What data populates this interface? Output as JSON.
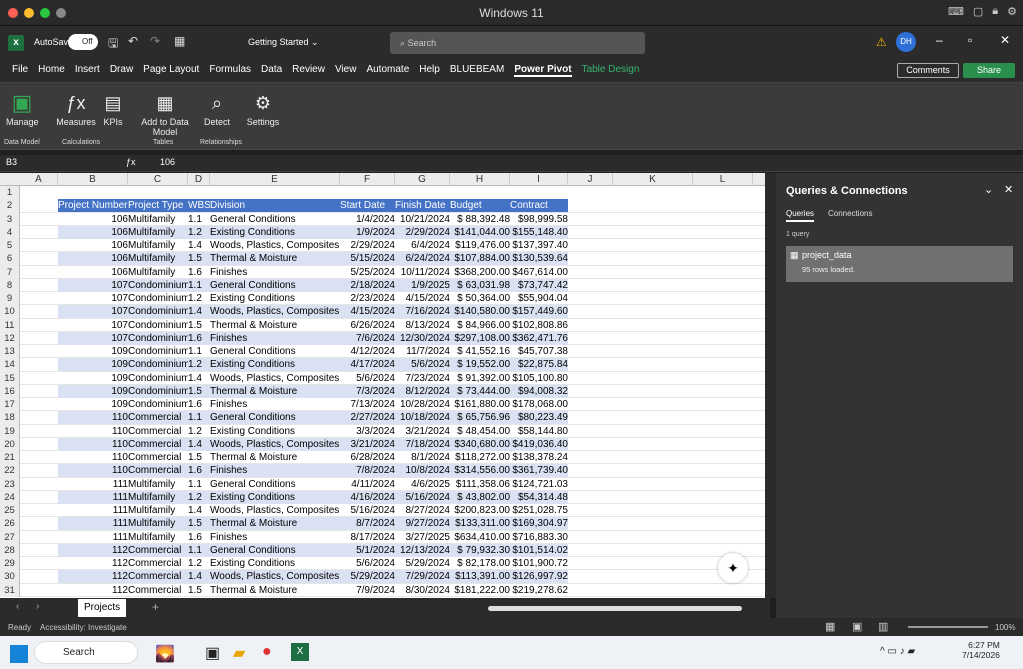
{
  "window": {
    "title": "Windows 11"
  },
  "titlebar": {
    "autosave": "AutoSave",
    "autosave_state": "Off",
    "filename": "Getting Started",
    "search_placeholder": "Search",
    "user_initials": "DH"
  },
  "menu": [
    "File",
    "Home",
    "Insert",
    "Draw",
    "Page Layout",
    "Formulas",
    "Data",
    "Review",
    "View",
    "Automate",
    "Help",
    "BLUEBEAM",
    "Power Pivot",
    "Table Design"
  ],
  "menu_actions": {
    "comments": "Comments",
    "share": "Share"
  },
  "ribbon": {
    "items": [
      {
        "label": "Manage",
        "icon": "manage-icon"
      },
      {
        "label": "Measures",
        "icon": "fx-icon"
      },
      {
        "label": "KPIs",
        "icon": "kpi-icon"
      },
      {
        "label": "Add to Data Model",
        "icon": "table-add-icon"
      },
      {
        "label": "Detect",
        "icon": "detect-icon"
      },
      {
        "label": "Settings",
        "icon": "gear-icon"
      }
    ],
    "groups": [
      "Data Model",
      "Calculations",
      "Tables",
      "Relationships"
    ]
  },
  "formula": {
    "cell": "B3",
    "value": "106"
  },
  "columns": [
    "A",
    "B",
    "C",
    "D",
    "E",
    "F",
    "G",
    "H",
    "I",
    "J",
    "K",
    "L"
  ],
  "table": {
    "headers": [
      "Project Number",
      "Project Type",
      "WBS",
      "Division",
      "Start Date",
      "Finish Date",
      "Budget",
      "Contract"
    ],
    "rows": [
      [
        "106",
        "Multifamily",
        "1.1",
        "General Conditions",
        "1/4/2024",
        "10/21/2024",
        "$ 88,392.48",
        "$98,999.58"
      ],
      [
        "106",
        "Multifamily",
        "1.2",
        "Existing Conditions",
        "1/9/2024",
        "2/29/2024",
        "$141,044.00",
        "$155,148.40"
      ],
      [
        "106",
        "Multifamily",
        "1.4",
        "Woods, Plastics, Composites",
        "2/29/2024",
        "6/4/2024",
        "$119,476.00",
        "$137,397.40"
      ],
      [
        "106",
        "Multifamily",
        "1.5",
        "Thermal & Moisture",
        "5/15/2024",
        "6/24/2024",
        "$107,884.00",
        "$130,539.64"
      ],
      [
        "106",
        "Multifamily",
        "1.6",
        "Finishes",
        "5/25/2024",
        "10/11/2024",
        "$368,200.00",
        "$467,614.00"
      ],
      [
        "107",
        "Condominium",
        "1.1",
        "General Conditions",
        "2/18/2024",
        "1/9/2025",
        "$ 63,031.98",
        "$73,747.42"
      ],
      [
        "107",
        "Condominium",
        "1.2",
        "Existing Conditions",
        "2/23/2024",
        "4/15/2024",
        "$ 50,364.00",
        "$55,904.04"
      ],
      [
        "107",
        "Condominium",
        "1.4",
        "Woods, Plastics, Composites",
        "4/15/2024",
        "7/16/2024",
        "$140,580.00",
        "$157,449.60"
      ],
      [
        "107",
        "Condominium",
        "1.5",
        "Thermal & Moisture",
        "6/26/2024",
        "8/13/2024",
        "$ 84,966.00",
        "$102,808.86"
      ],
      [
        "107",
        "Condominium",
        "1.6",
        "Finishes",
        "7/6/2024",
        "12/30/2024",
        "$297,108.00",
        "$362,471.76"
      ],
      [
        "109",
        "Condominium",
        "1.1",
        "General Conditions",
        "4/12/2024",
        "11/7/2024",
        "$ 41,552.16",
        "$45,707.38"
      ],
      [
        "109",
        "Condominium",
        "1.2",
        "Existing Conditions",
        "4/17/2024",
        "5/6/2024",
        "$ 19,552.00",
        "$22,875.84"
      ],
      [
        "109",
        "Condominium",
        "1.4",
        "Woods, Plastics, Composites",
        "5/6/2024",
        "7/23/2024",
        "$ 91,392.00",
        "$105,100.80"
      ],
      [
        "109",
        "Condominium",
        "1.5",
        "Thermal & Moisture",
        "7/3/2024",
        "8/12/2024",
        "$ 73,444.00",
        "$94,008.32"
      ],
      [
        "109",
        "Condominium",
        "1.6",
        "Finishes",
        "7/13/2024",
        "10/28/2024",
        "$161,880.00",
        "$178,068.00"
      ],
      [
        "110",
        "Commercial",
        "1.1",
        "General Conditions",
        "2/27/2024",
        "10/18/2024",
        "$ 65,756.96",
        "$80,223.49"
      ],
      [
        "110",
        "Commercial",
        "1.2",
        "Existing Conditions",
        "3/3/2024",
        "3/21/2024",
        "$ 48,454.00",
        "$58,144.80"
      ],
      [
        "110",
        "Commercial",
        "1.4",
        "Woods, Plastics, Composites",
        "3/21/2024",
        "7/18/2024",
        "$340,680.00",
        "$419,036.40"
      ],
      [
        "110",
        "Commercial",
        "1.5",
        "Thermal & Moisture",
        "6/28/2024",
        "8/1/2024",
        "$118,272.00",
        "$138,378.24"
      ],
      [
        "110",
        "Commercial",
        "1.6",
        "Finishes",
        "7/8/2024",
        "10/8/2024",
        "$314,556.00",
        "$361,739.40"
      ],
      [
        "111",
        "Multifamily",
        "1.1",
        "General Conditions",
        "4/11/2024",
        "4/6/2025",
        "$111,358.06",
        "$124,721.03"
      ],
      [
        "111",
        "Multifamily",
        "1.2",
        "Existing Conditions",
        "4/16/2024",
        "5/16/2024",
        "$ 43,802.00",
        "$54,314.48"
      ],
      [
        "111",
        "Multifamily",
        "1.4",
        "Woods, Plastics, Composites",
        "5/16/2024",
        "8/27/2024",
        "$200,823.00",
        "$251,028.75"
      ],
      [
        "111",
        "Multifamily",
        "1.5",
        "Thermal & Moisture",
        "8/7/2024",
        "9/27/2024",
        "$133,311.00",
        "$169,304.97"
      ],
      [
        "111",
        "Multifamily",
        "1.6",
        "Finishes",
        "8/17/2024",
        "3/27/2025",
        "$634,410.00",
        "$716,883.30"
      ],
      [
        "112",
        "Commercial",
        "1.1",
        "General Conditions",
        "5/1/2024",
        "12/13/2024",
        "$ 79,932.30",
        "$101,514.02"
      ],
      [
        "112",
        "Commercial",
        "1.2",
        "Existing Conditions",
        "5/6/2024",
        "5/29/2024",
        "$ 82,178.00",
        "$101,900.72"
      ],
      [
        "112",
        "Commercial",
        "1.4",
        "Woods, Plastics, Composites",
        "5/29/2024",
        "7/29/2024",
        "$113,391.00",
        "$126,997.92"
      ],
      [
        "112",
        "Commercial",
        "1.5",
        "Thermal & Moisture",
        "7/9/2024",
        "8/30/2024",
        "$181,222.00",
        "$219,278.62"
      ]
    ]
  },
  "row_numbers": [
    "1",
    "2",
    "3",
    "4",
    "5",
    "6",
    "7",
    "8",
    "9",
    "10",
    "11",
    "12",
    "13",
    "14",
    "15",
    "16",
    "17",
    "18",
    "19",
    "20",
    "21",
    "22",
    "23",
    "24",
    "25",
    "26",
    "27",
    "28",
    "29",
    "30",
    "31"
  ],
  "sheet": {
    "tab": "Projects"
  },
  "sidepane": {
    "title": "Queries & Connections",
    "tabs": [
      "Queries",
      "Connections"
    ],
    "count": "1 query",
    "query_name": "project_data",
    "query_status": "95 rows loaded."
  },
  "status": {
    "ready": "Ready",
    "accessibility": "Accessibility: Investigate",
    "zoom": "100%"
  },
  "taskbar": {
    "search": "Search",
    "time": "6:27 PM",
    "date": "7/14/2026"
  }
}
